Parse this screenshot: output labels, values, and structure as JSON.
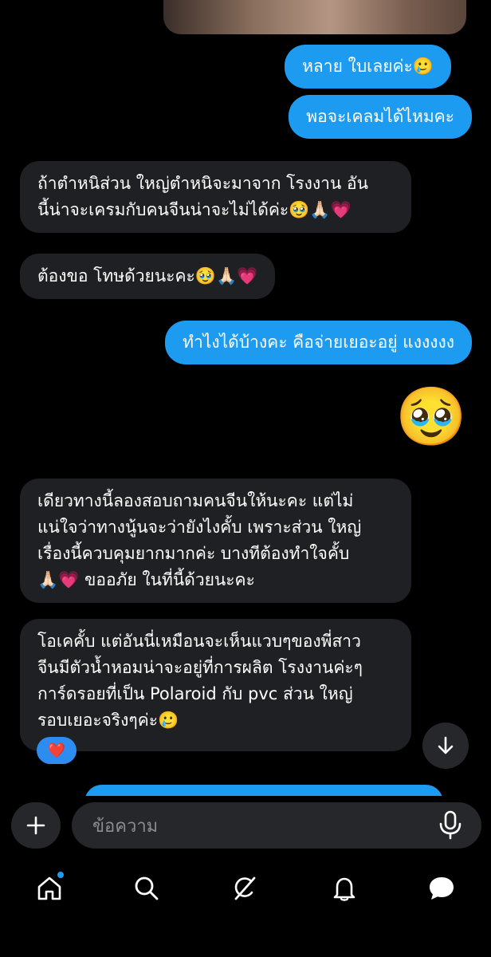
{
  "messages": [
    {
      "side": "out",
      "text": "หลาย ใบเลยค่ะ🥲"
    },
    {
      "side": "out",
      "text": "พอจะเคลมได้ไหมคะ"
    },
    {
      "side": "in",
      "lines": [
        "ถ้าตำหนิส่วน ใหญ่ตำหนิจะมาจาก โรงงาน อัน",
        "นี้น่าจะเครมกับคนจีนน่าจะไม่ได้ค่ะ🥹🙏🏻💗"
      ]
    },
    {
      "side": "in",
      "text": "ต้องขอ โทษด้วยนะคะ🥹🙏🏻💗"
    },
    {
      "side": "out",
      "text": "ทำไงได้บ้างคะ คือจ่ายเยอะอยู่ แงงงงง"
    },
    {
      "side": "out",
      "emoji": "🥹"
    },
    {
      "side": "in",
      "lines": [
        "เดียวทางนี้ลองสอบถามคนจีนให้นะคะ แต่ไม่",
        "แน่ใจว่าทางนู้นจะว่ายังไงคั้บ เพราะส่วน ใหญ่",
        "เรื่องนี้ควบคุมยากมากค่ะ บางทีต้องทำใจคั้บ",
        "🙏🏻💗 ขออภัย ในที่นี้ด้วยนะคะ"
      ]
    },
    {
      "side": "in",
      "lines": [
        "โอเคคั้บ แต่อันนี่เหมือนจะเห็นแวบๆของพี่สาว",
        "จีนมีตัวน้ำหอมน่าจะอยู่ที่การผลิต โรงงานค่ะๆ",
        "การ์ดรอยที่เป็น Polaroid กับ pvc ส่วน ใหญ่",
        "รอบเยอะจริงๆค่ะ🥲"
      ],
      "reaction": "❤️"
    }
  ],
  "composer": {
    "placeholder": "ข้อความ"
  },
  "icons": {
    "plus": "plus-icon",
    "mic": "microphone-icon",
    "scroll_down": "arrow-down-icon",
    "nav": [
      "home-icon",
      "search-icon",
      "grok-slash-icon",
      "bell-icon",
      "messages-icon"
    ]
  },
  "colors": {
    "outgoing": "#1d9bf0",
    "incoming": "#1f2023",
    "background": "#000000"
  }
}
